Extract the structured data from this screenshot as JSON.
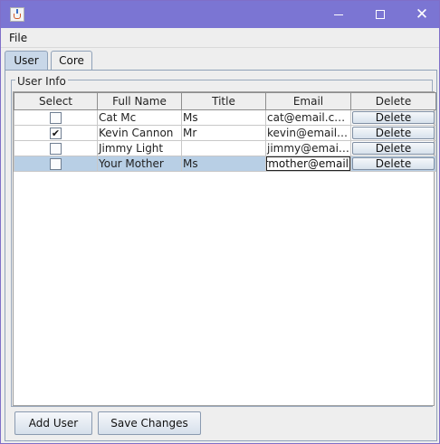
{
  "window": {
    "icon": "java-icon",
    "controls": {
      "minimize": "minimize-icon",
      "maximize": "maximize-icon",
      "close": "close-icon"
    }
  },
  "menu": {
    "file": "File"
  },
  "tabs": [
    {
      "label": "User",
      "selected": true
    },
    {
      "label": "Core",
      "selected": false
    }
  ],
  "panel": {
    "legend": "User Info"
  },
  "table": {
    "columns": [
      "Select",
      "Full Name",
      "Title",
      "Email",
      "Delete"
    ],
    "rows": [
      {
        "checked": false,
        "name": "Cat  Mc",
        "title": "Ms",
        "email": "cat@email.com",
        "delete": "Delete"
      },
      {
        "checked": true,
        "name": "Kevin Cannon",
        "title": "Mr",
        "email": "kevin@email.c...",
        "delete": "Delete"
      },
      {
        "checked": false,
        "name": "Jimmy Light",
        "title": "",
        "email": "jimmy@email....",
        "delete": "Delete"
      },
      {
        "checked": false,
        "name": "Your Mother",
        "title": "Ms",
        "email": "rmother@email",
        "delete": "Delete",
        "selected": true,
        "editing_email": true
      }
    ]
  },
  "buttons": {
    "add_user": "Add User",
    "save_changes": "Save Changes"
  },
  "colors": {
    "titlebar": "#7b75d3",
    "selection": "#b8cfe5",
    "tab_selected": "#c8d7e8"
  }
}
